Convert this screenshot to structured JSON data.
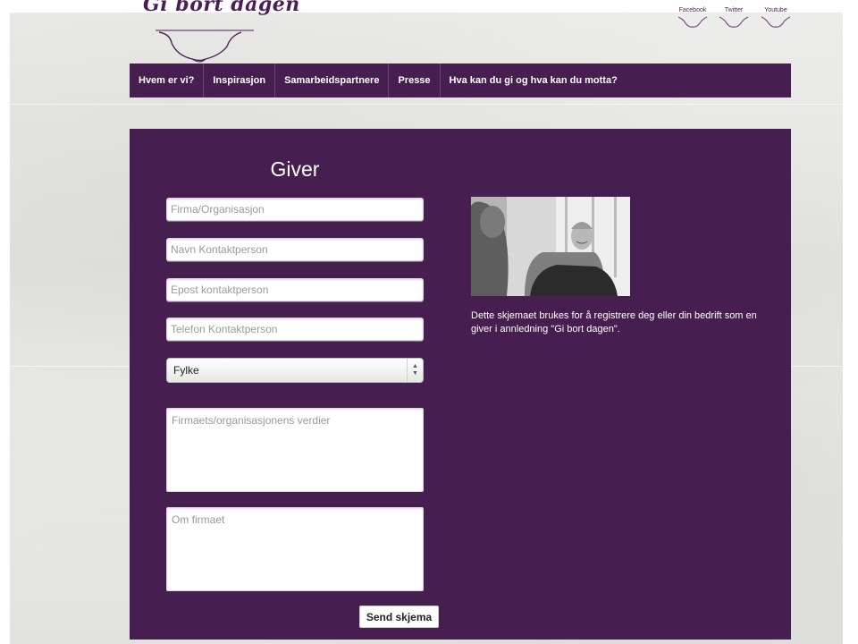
{
  "header": {
    "logo_text": "Gi bort dagen",
    "social": [
      {
        "label": "Facebook",
        "icon": "facebook-badge-icon"
      },
      {
        "label": "Twitter",
        "icon": "twitter-badge-icon"
      },
      {
        "label": "Youtube",
        "icon": "youtube-badge-icon"
      }
    ]
  },
  "nav": {
    "items": [
      {
        "label": "Hvem er vi?"
      },
      {
        "label": "Inspirasjon"
      },
      {
        "label": "Samarbeidspartnere"
      },
      {
        "label": "Presse"
      },
      {
        "label": "Hva kan du gi og hva kan du motta?"
      }
    ]
  },
  "form": {
    "title": "Giver",
    "fields": {
      "company": {
        "placeholder": "Firma/Organisasjon",
        "value": ""
      },
      "contact_name": {
        "placeholder": "Navn Kontaktperson",
        "value": ""
      },
      "contact_email": {
        "placeholder": "Epost kontaktperson",
        "value": ""
      },
      "contact_phone": {
        "placeholder": "Telefon Kontaktperson",
        "value": ""
      }
    },
    "county_select": {
      "selected": "Fylke"
    },
    "values_textarea": {
      "placeholder": "Firmaets/organisasjonens verdier"
    },
    "about_textarea": {
      "placeholder": "Om firmaet"
    },
    "submit_label": "Send skjema"
  },
  "aside": {
    "photo_icon": "photo-two-people-talking",
    "description": "Dette skjemaet brukes for å registrere deg eller din bedrift som en giver i annledning \"Gi bort dagen\"."
  },
  "colors": {
    "brand_purple": "#461e4f",
    "nav_divider": "#6a4470",
    "page_background": "#e6e6e3"
  }
}
